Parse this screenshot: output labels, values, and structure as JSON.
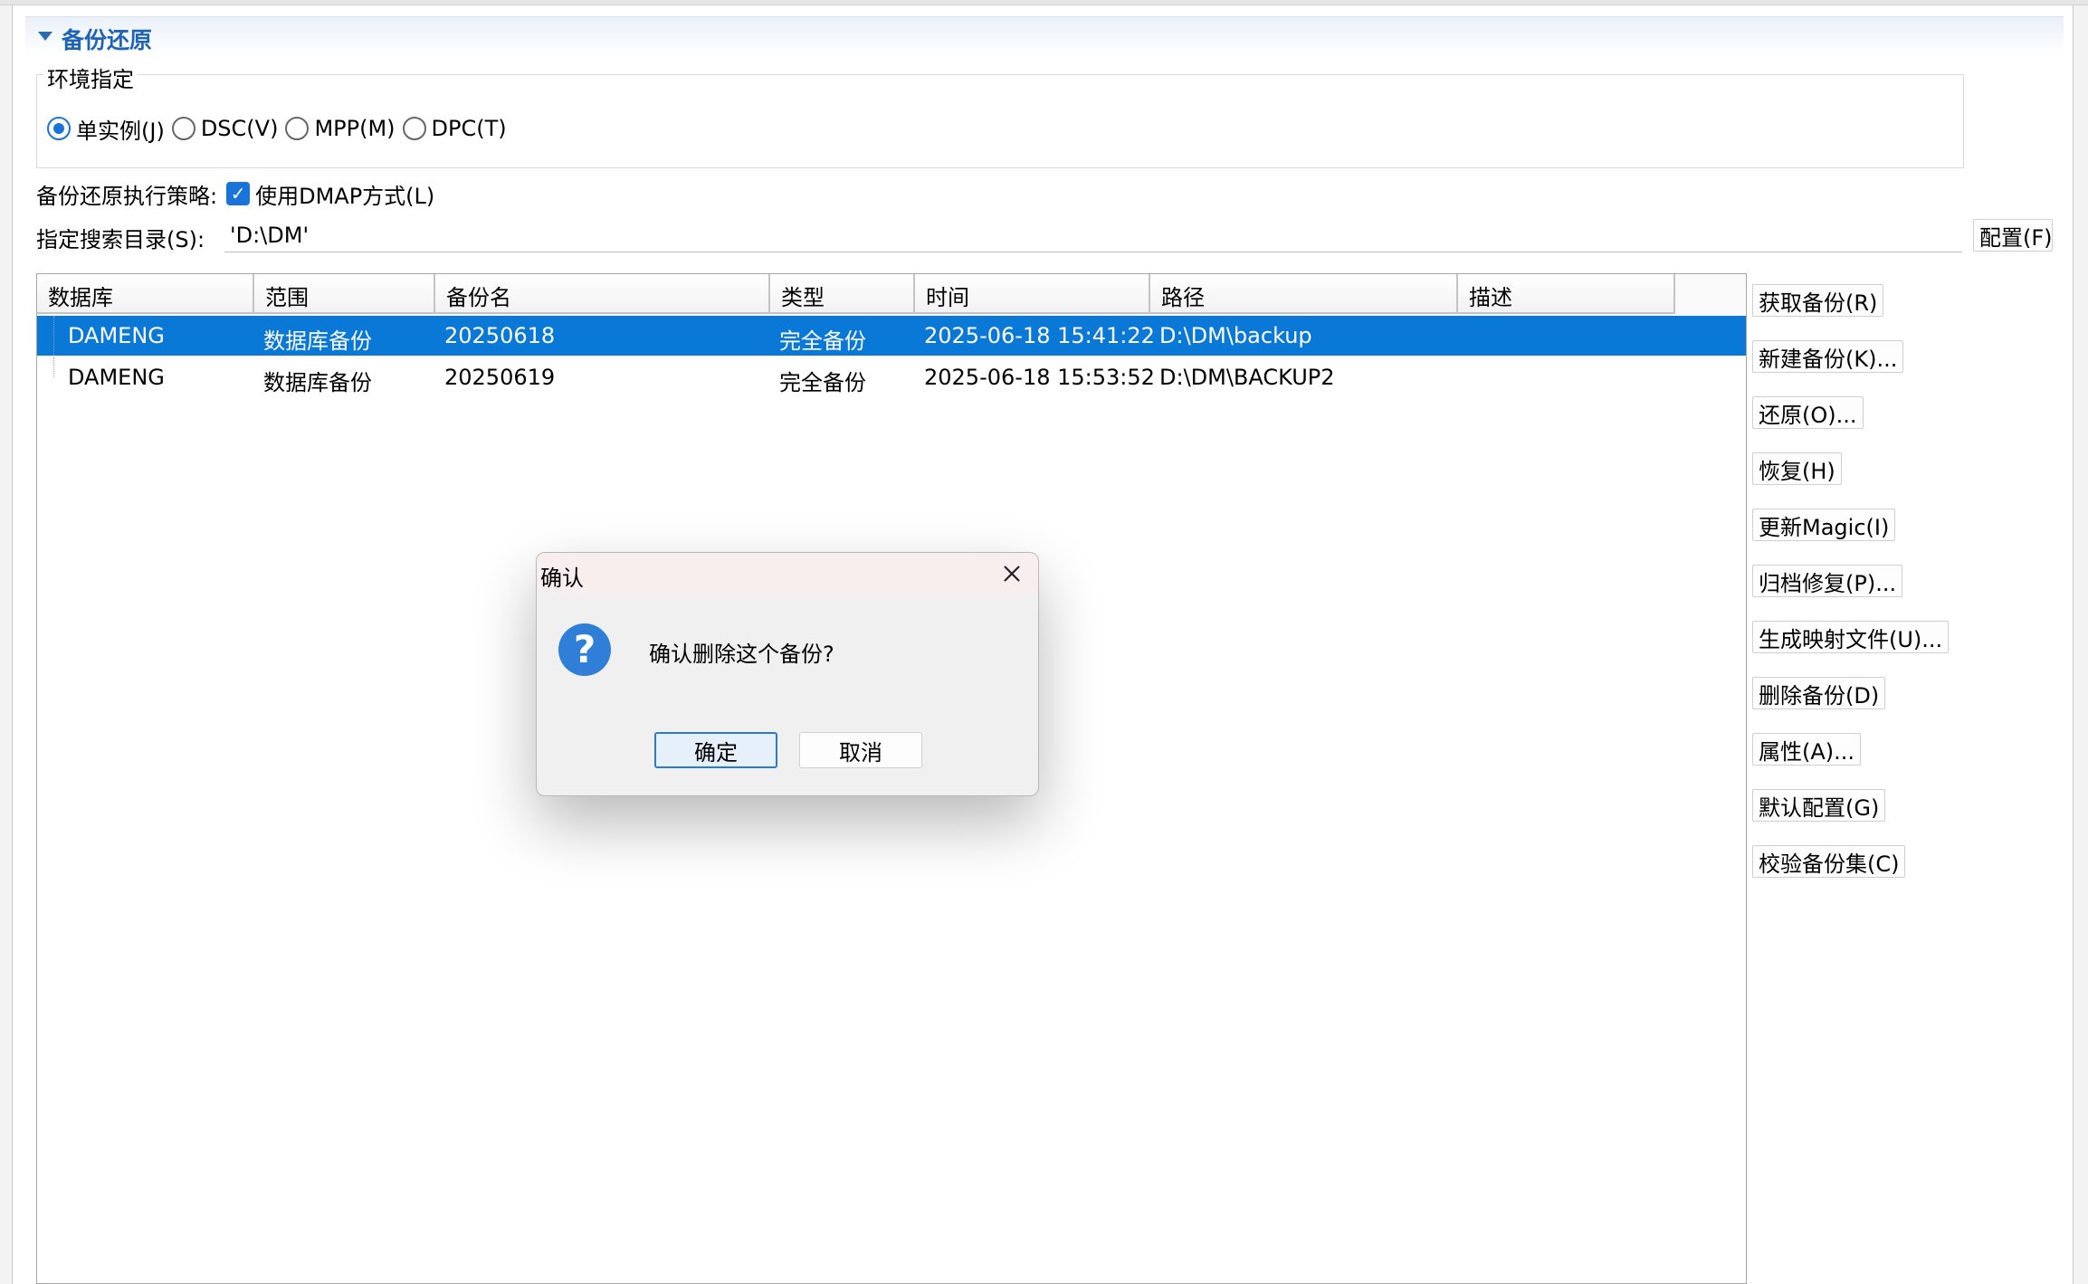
{
  "section": {
    "title": "备份还原"
  },
  "environment": {
    "legend": "环境指定",
    "options": [
      "单实例(J)",
      "DSC(V)",
      "MPP(M)",
      "DPC(T)"
    ],
    "selected": "单实例(J)"
  },
  "strategy": {
    "label": "备份还原执行策略:",
    "checkbox_label": "使用DMAP方式(L)",
    "checked": true
  },
  "search_dir": {
    "label": "指定搜索目录(S):",
    "value": "'D:\\DM'",
    "config_button": "配置(F)"
  },
  "table": {
    "columns": [
      "数据库",
      "范围",
      "备份名",
      "类型",
      "时间",
      "路径",
      "描述"
    ],
    "rows": [
      {
        "database": "DAMENG",
        "scope": "数据库备份",
        "name": "20250618",
        "type": "完全备份",
        "time": "2025-06-18 15:41:22",
        "path": "D:\\DM\\backup",
        "desc": "",
        "selected": true
      },
      {
        "database": "DAMENG",
        "scope": "数据库备份",
        "name": "20250619",
        "type": "完全备份",
        "time": "2025-06-18 15:53:52",
        "path": "D:\\DM\\BACKUP2",
        "desc": "",
        "selected": false
      }
    ]
  },
  "side_buttons": [
    "获取备份(R)",
    "新建备份(K)...",
    "还原(O)...",
    "恢复(H)",
    "更新Magic(I)",
    "归档修复(P)...",
    "生成映射文件(U)...",
    "删除备份(D)",
    "属性(A)...",
    "默认配置(G)",
    "校验备份集(C)"
  ],
  "dialog": {
    "title": "确认",
    "message": "确认删除这个备份?",
    "ok": "确定",
    "cancel": "取消",
    "icon": "question-icon"
  },
  "colors": {
    "selection": "#0a78d7",
    "accent": "#1f63b4",
    "dialog_icon": "#2f7ed8"
  }
}
